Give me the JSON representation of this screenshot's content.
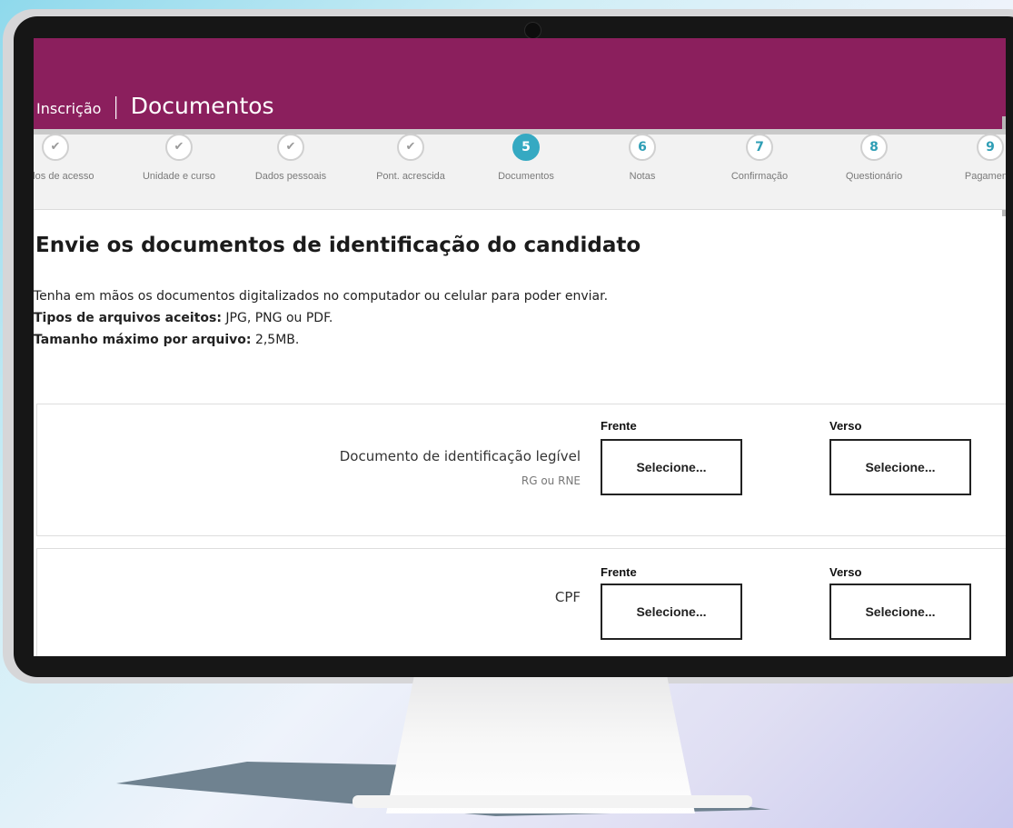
{
  "header": {
    "breadcrumb": "Inscrição",
    "separator": "|",
    "title": "Documentos",
    "brand_color": "#8b1f5d"
  },
  "stepper": {
    "steps": [
      {
        "number": "✔",
        "label": "Dados de acesso",
        "status": "done"
      },
      {
        "number": "✔",
        "label": "Unidade e curso",
        "status": "done"
      },
      {
        "number": "✔",
        "label": "Dados pessoais",
        "status": "done"
      },
      {
        "number": "✔",
        "label": "Pont. acrescida",
        "status": "done"
      },
      {
        "number": "5",
        "label": "Documentos",
        "status": "active"
      },
      {
        "number": "6",
        "label": "Notas",
        "status": "pending"
      },
      {
        "number": "7",
        "label": "Confirmação",
        "status": "pending"
      },
      {
        "number": "8",
        "label": "Questionário",
        "status": "pending"
      },
      {
        "number": "9",
        "label": "Pagamento",
        "status": "pending"
      }
    ],
    "active_color": "#35a9c2"
  },
  "main": {
    "heading": "Envie os documentos de identificação do candidato",
    "intro_line": "Tenha em mãos os documentos digitalizados no computador ou celular para poder enviar.",
    "file_types_label": "Tipos de arquivos aceitos:",
    "file_types_value": " JPG, PNG ou PDF.",
    "max_size_label": "Tamanho máximo por arquivo:",
    "max_size_value": " 2,5MB."
  },
  "documents": [
    {
      "name": "Documento de identificação legível",
      "subtitle": "RG ou RNE",
      "front_label": "Frente",
      "back_label": "Verso",
      "front_button": "Selecione...",
      "back_button": "Selecione..."
    },
    {
      "name": "CPF",
      "subtitle": "",
      "front_label": "Frente",
      "back_label": "Verso",
      "front_button": "Selecione...",
      "back_button": "Selecione..."
    }
  ]
}
